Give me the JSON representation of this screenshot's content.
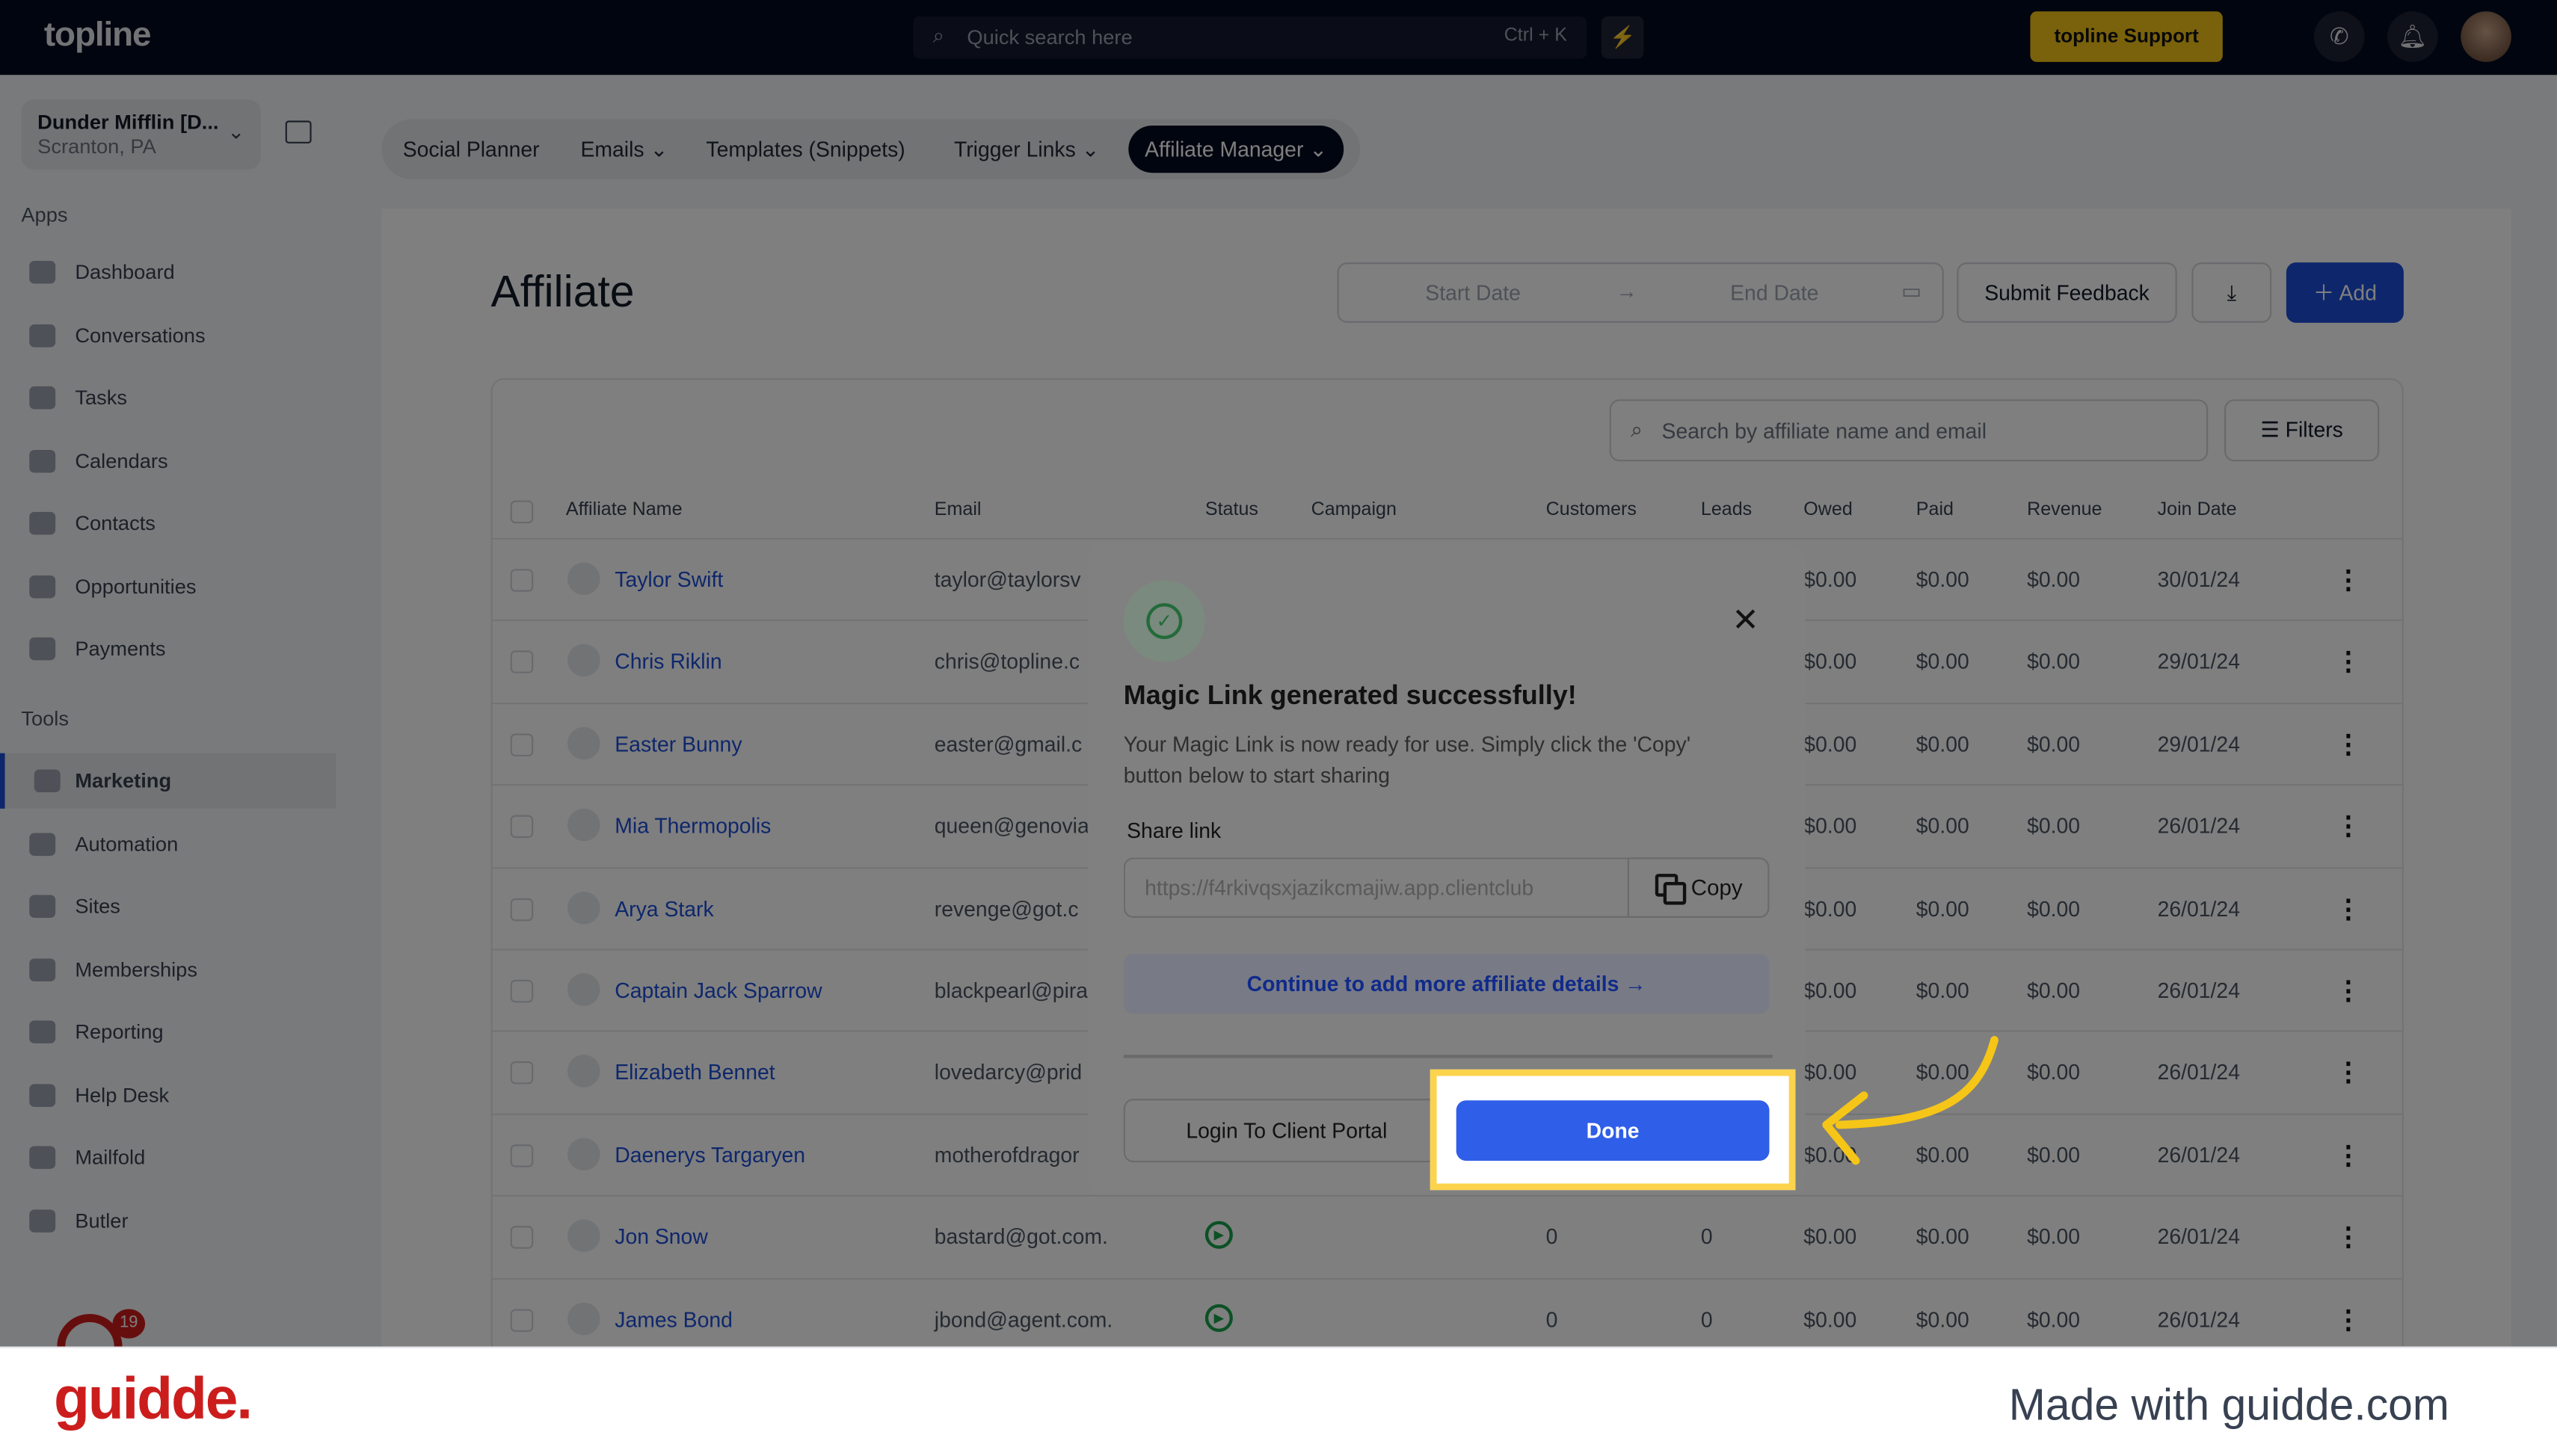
{
  "topbar": {
    "logo": "topline",
    "search_placeholder": "Quick search here",
    "shortcut": "Ctrl + K",
    "support": "topline Support"
  },
  "sidebar": {
    "location_name": "Dunder Mifflin [D...",
    "location_sub": "Scranton, PA",
    "apps_label": "Apps",
    "tools_label": "Tools",
    "apps": [
      "Dashboard",
      "Conversations",
      "Tasks",
      "Calendars",
      "Contacts",
      "Opportunities",
      "Payments"
    ],
    "tools": [
      "Marketing",
      "Automation",
      "Sites",
      "Memberships",
      "Reporting",
      "Help Desk",
      "Mailfold",
      "Butler"
    ],
    "active": "Marketing",
    "notif_count": "19"
  },
  "tabs": [
    "Social Planner",
    "Emails",
    "Templates (Snippets)",
    "Trigger Links",
    "Affiliate Manager"
  ],
  "page": {
    "title": "Affiliate",
    "start_date": "Start Date",
    "end_date": "End Date",
    "submit_feedback": "Submit Feedback",
    "add": "Add",
    "search_placeholder": "Search by affiliate name and email",
    "filters": "Filters"
  },
  "table": {
    "headers": [
      "Affiliate Name",
      "Email",
      "Status",
      "Campaign",
      "Customers",
      "Leads",
      "Owed",
      "Paid",
      "Revenue",
      "Join Date"
    ],
    "rows": [
      {
        "name": "Taylor Swift",
        "email": "taylor@taylorsv",
        "customers": "",
        "leads": "",
        "owed": "$0.00",
        "paid": "$0.00",
        "revenue": "$0.00",
        "date": "30/01/24"
      },
      {
        "name": "Chris Riklin",
        "email": "chris@topline.c",
        "customers": "",
        "leads": "",
        "owed": "$0.00",
        "paid": "$0.00",
        "revenue": "$0.00",
        "date": "29/01/24"
      },
      {
        "name": "Easter Bunny",
        "email": "easter@gmail.c",
        "customers": "",
        "leads": "",
        "owed": "$0.00",
        "paid": "$0.00",
        "revenue": "$0.00",
        "date": "29/01/24"
      },
      {
        "name": "Mia Thermopolis",
        "email": "queen@genovia",
        "customers": "",
        "leads": "",
        "owed": "$0.00",
        "paid": "$0.00",
        "revenue": "$0.00",
        "date": "26/01/24"
      },
      {
        "name": "Arya Stark",
        "email": "revenge@got.c",
        "customers": "",
        "leads": "",
        "owed": "$0.00",
        "paid": "$0.00",
        "revenue": "$0.00",
        "date": "26/01/24"
      },
      {
        "name": "Captain Jack Sparrow",
        "email": "blackpearl@pira",
        "customers": "",
        "leads": "",
        "owed": "$0.00",
        "paid": "$0.00",
        "revenue": "$0.00",
        "date": "26/01/24"
      },
      {
        "name": "Elizabeth Bennet",
        "email": "lovedarcy@prid",
        "customers": "",
        "leads": "",
        "owed": "$0.00",
        "paid": "$0.00",
        "revenue": "$0.00",
        "date": "26/01/24"
      },
      {
        "name": "Daenerys Targaryen",
        "email": "motherofdragor",
        "customers": "",
        "leads": "",
        "owed": "$0.00",
        "paid": "$0.00",
        "revenue": "$0.00",
        "date": "26/01/24"
      },
      {
        "name": "Jon Snow",
        "email": "bastard@got.com.",
        "customers": "0",
        "leads": "0",
        "owed": "$0.00",
        "paid": "$0.00",
        "revenue": "$0.00",
        "date": "26/01/24",
        "status": "active"
      },
      {
        "name": "James Bond",
        "email": "jbond@agent.com.",
        "customers": "0",
        "leads": "0",
        "owed": "$0.00",
        "paid": "$0.00",
        "revenue": "$0.00",
        "date": "26/01/24",
        "status": "active"
      }
    ]
  },
  "modal": {
    "title": "Magic Link generated successfully!",
    "description": "Your Magic Link is now ready for use. Simply click the 'Copy' button below to start sharing",
    "share_label": "Share link",
    "link": "https://f4rkivqsxjazikcmajiw.app.clientclub",
    "copy": "Copy",
    "continue": "Continue to add more affiliate details",
    "login": "Login To Client Portal",
    "done": "Done"
  },
  "footer": {
    "logo": "guidde.",
    "made_with": "Made with guidde.com"
  },
  "colors": {
    "accent": "#2f5ee8",
    "highlight": "#fcd34d",
    "topbar": "#030a1f"
  }
}
